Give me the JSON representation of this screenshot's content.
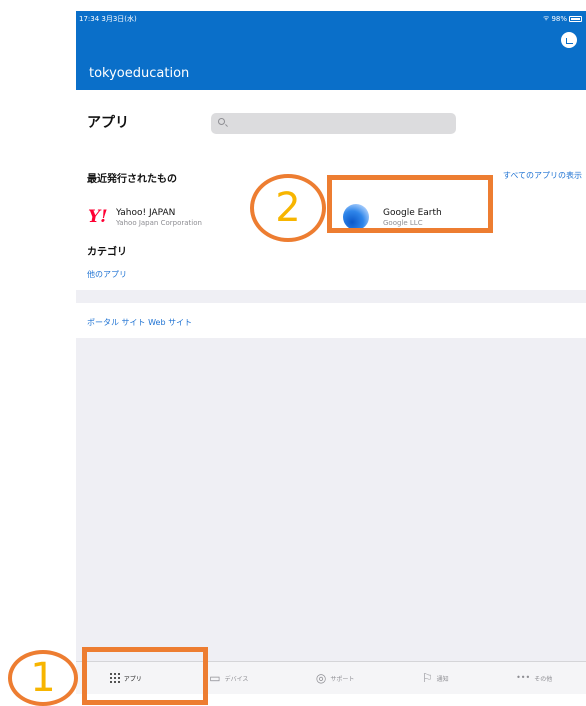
{
  "status": {
    "time": "17:34 3月3日(水)",
    "battery": "98%"
  },
  "header": {
    "org_name": "tokyoeducation"
  },
  "apps": {
    "title": "アプリ",
    "search_placeholder": "",
    "recent_label": "最近発行されたもの",
    "view_all": "すべてのアプリの表示",
    "recent_items": [
      {
        "name": "Yahoo! JAPAN",
        "publisher": "Yahoo Japan Corporation",
        "logo_text": "Y!"
      },
      {
        "name": "Google Earth",
        "publisher": "Google LLC"
      }
    ],
    "category_label": "カテゴリ",
    "other_apps": "他のアプリ"
  },
  "portal": {
    "link": "ポータル サイト Web サイト"
  },
  "tabbar": {
    "items": [
      {
        "label": "アプリ",
        "icon": "grid-icon",
        "active": true
      },
      {
        "label": "デバイス",
        "icon": "device-icon",
        "glyph": "▭"
      },
      {
        "label": "サポート",
        "icon": "headset-icon",
        "glyph": "◎"
      },
      {
        "label": "通知",
        "icon": "flag-icon",
        "glyph": "⚐"
      },
      {
        "label": "その他",
        "icon": "more-icon",
        "glyph": "•••"
      }
    ]
  },
  "annotations": {
    "step1": "1",
    "step2": "2",
    "color": "#ed7d31",
    "number_color": "#f7b500"
  }
}
